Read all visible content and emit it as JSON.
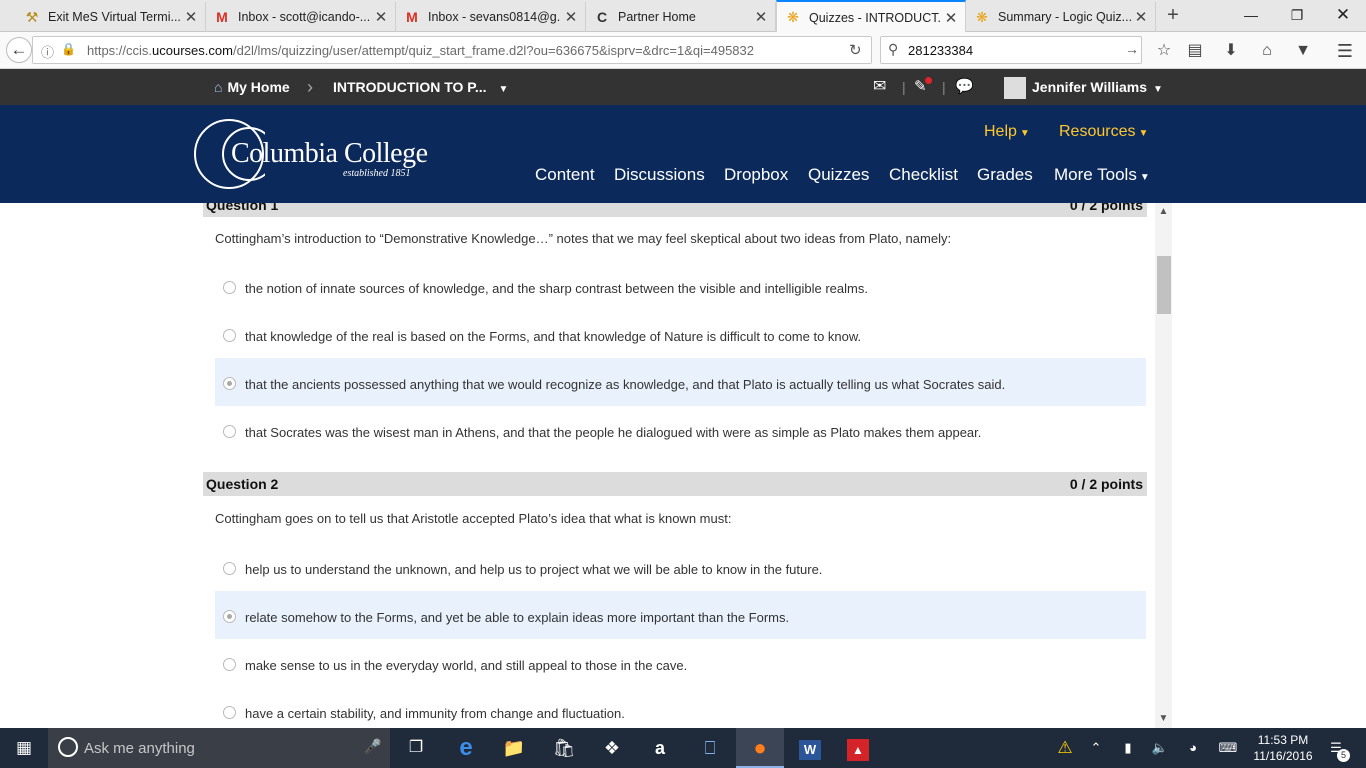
{
  "browser": {
    "tabs": [
      {
        "title": "Exit MeS Virtual Termi...",
        "icon": "mes-icon",
        "active": false
      },
      {
        "title": "Inbox - scott@icando-...",
        "icon": "gmail-icon",
        "active": false
      },
      {
        "title": "Inbox - sevans0814@g...",
        "icon": "gmail-icon",
        "active": false
      },
      {
        "title": "Partner Home",
        "icon": "partner-icon",
        "active": false
      },
      {
        "title": "Quizzes - INTRODUCT...",
        "icon": "d2l-icon",
        "active": true
      },
      {
        "title": "Summary - Logic Quiz...",
        "icon": "d2l-icon",
        "active": false
      }
    ],
    "url_prefix": "https://ccis.",
    "url_domain": "ucourses.com",
    "url_rest": "/d2l/lms/quizzing/user/attempt/quiz_start_frame.d2l?ou=636675&isprv=&drc=1&qi=495832",
    "search_value": "281233384"
  },
  "d2l_bar": {
    "home_label": "My Home",
    "course_label": "INTRODUCTION TO P...",
    "user_name": "Jennifer Williams"
  },
  "header": {
    "logo_name": "Columbia College",
    "logo_tagline": "established 1851",
    "help_label": "Help",
    "resources_label": "Resources",
    "nav": [
      "Content",
      "Discussions",
      "Dropbox",
      "Quizzes",
      "Checklist",
      "Grades",
      "More Tools"
    ]
  },
  "quiz": {
    "questions": [
      {
        "title": "Question 1",
        "points": "0 / 2 points",
        "text": "Cottingham’s introduction to “Demonstrative Knowledge…” notes that we may feel skeptical about two ideas from Plato, namely:",
        "options": [
          "the notion of innate sources of knowledge, and the sharp contrast between the visible and intelligible realms.",
          "that knowledge of the real is based on the Forms, and that knowledge of Nature is difficult to come to know.",
          "that the ancients possessed anything that we would recognize as knowledge, and that Plato is actually telling us what Socrates said.",
          "that Socrates was the wisest man in Athens, and that the people he dialogued with were as simple as Plato makes them appear."
        ],
        "selected_index": 2
      },
      {
        "title": "Question 2",
        "points": "0 / 2 points",
        "text": "Cottingham goes on to tell us that Aristotle accepted Plato’s idea that what is known must:",
        "options": [
          "help us to understand the unknown, and help us to project what we will be able to know in the future.",
          "relate somehow to the Forms, and yet be able to explain ideas more important than the Forms.",
          "make sense to us in the everyday world, and still appeal to those in the cave.",
          "have a certain stability, and immunity from change and fluctuation."
        ],
        "selected_index": 1
      }
    ]
  },
  "taskbar": {
    "search_placeholder": "Ask me anything",
    "time": "11:53 PM",
    "date": "11/16/2016",
    "notification_count": "5"
  },
  "colors": {
    "header_navy": "#0b2a5b",
    "header_gold": "#ffc72c",
    "d2l_bar": "#333333",
    "selected_option_bg": "#e9f1fc",
    "tab_accent": "#0a84ff"
  }
}
